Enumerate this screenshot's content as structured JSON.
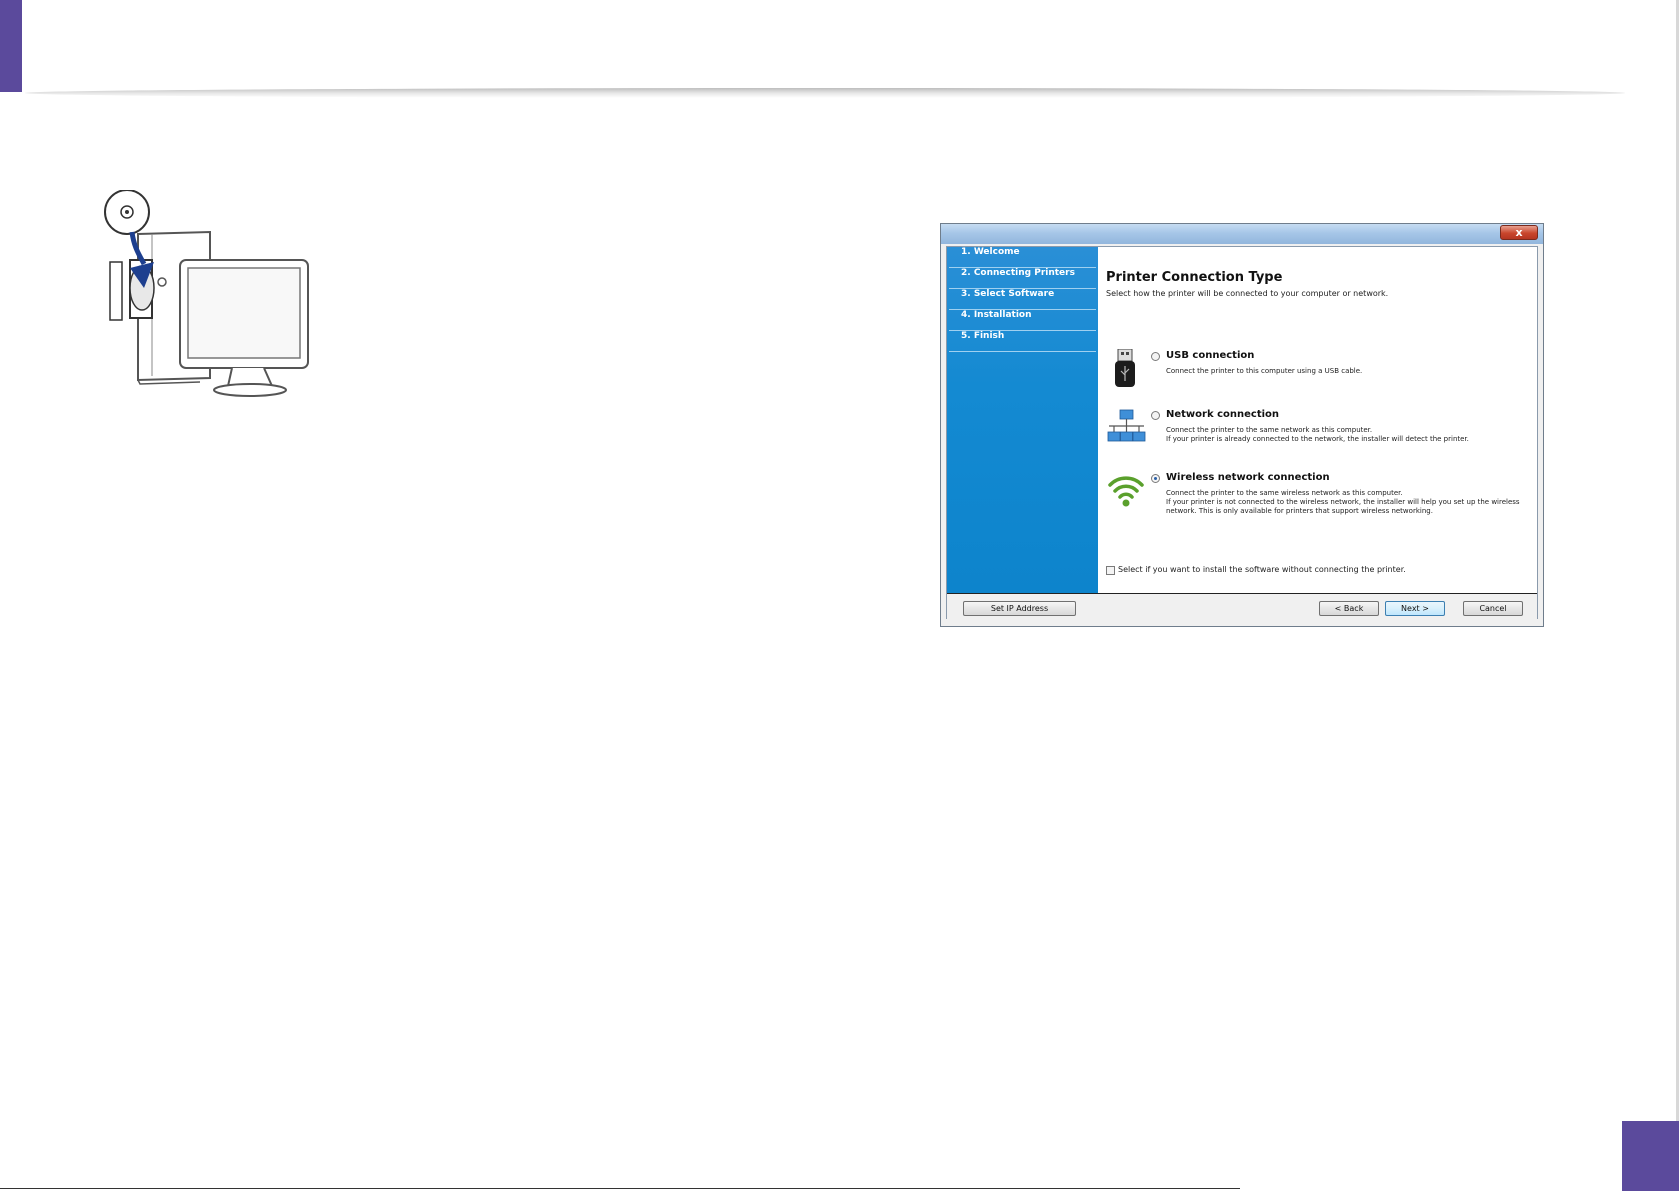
{
  "dialog": {
    "close_label": "x",
    "steps": [
      "1. Welcome",
      "2. Connecting Printers",
      "3. Select Software",
      "4. Installation",
      "5. Finish"
    ],
    "title": "Printer Connection Type",
    "subtitle": "Select how the printer will be connected to your computer or network.",
    "options": [
      {
        "label": "USB connection",
        "desc": "Connect the printer to this computer using a USB cable.",
        "icon": "usb-icon",
        "selected": false
      },
      {
        "label": "Network connection",
        "desc": "Connect the printer to the same network as this computer.\nIf your printer is already connected to the network, the installer will detect the printer.",
        "icon": "network-icon",
        "selected": false
      },
      {
        "label": "Wireless network connection",
        "desc": "Connect the printer to the same wireless network as this computer.\nIf your printer is not connected to the wireless network, the installer will help you set up the wireless network. This is only available for printers that support wireless networking.",
        "icon": "wifi-icon",
        "selected": true
      }
    ],
    "checkbox_label": "Select if you want to install the software without connecting the printer.",
    "buttons": {
      "set_ip": "Set IP Address",
      "back": "< Back",
      "next": "Next >",
      "cancel": "Cancel"
    }
  },
  "colors": {
    "accent": "#5b4a9c",
    "sidebar_blue": "#148ad2"
  }
}
